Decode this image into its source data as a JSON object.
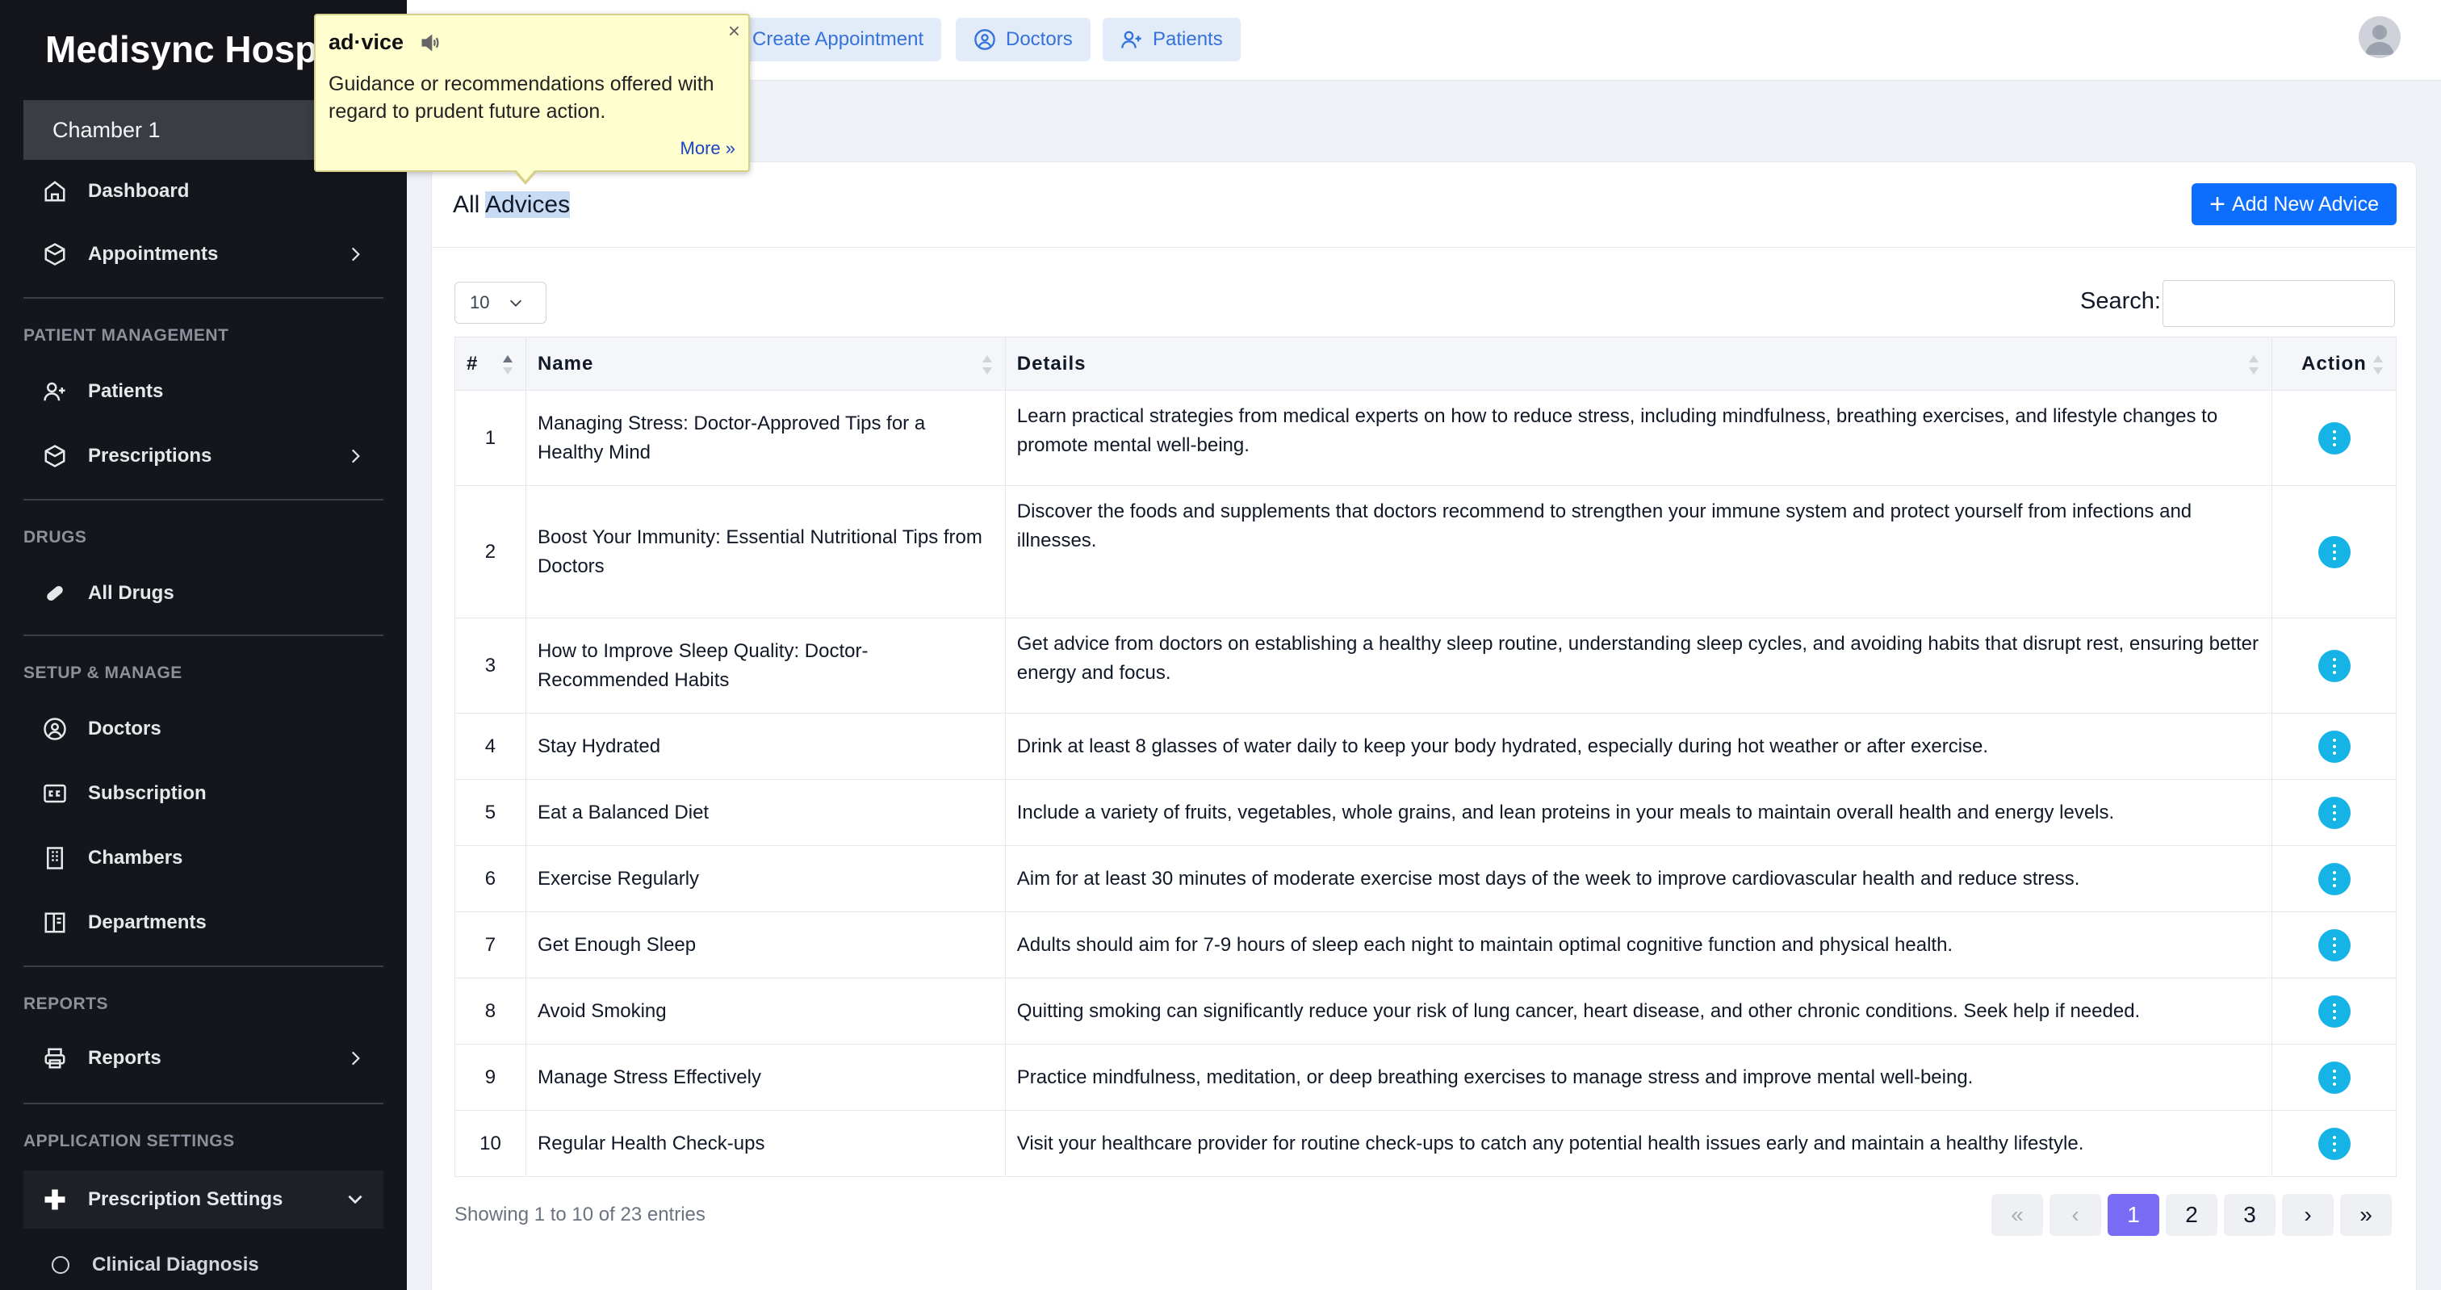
{
  "sidebar": {
    "brand": "Medisync Hospital",
    "chamber": "Chamber 1",
    "nav_top": [
      {
        "label": "Dashboard",
        "icon": "home-icon"
      },
      {
        "label": "Appointments",
        "icon": "hexagon-icon"
      }
    ],
    "sections": {
      "patient_management": "PATIENT MANAGEMENT",
      "drugs": "DRUGS",
      "setup_manage": "SETUP & MANAGE",
      "reports": "REPORTS",
      "application_settings": "APPLICATION SETTINGS"
    },
    "items": {
      "patients": "Patients",
      "prescriptions": "Prescriptions",
      "all_drugs": "All Drugs",
      "doctors": "Doctors",
      "subscription": "Subscription",
      "chambers": "Chambers",
      "departments": "Departments",
      "reports": "Reports",
      "prescription_settings": "Prescription Settings",
      "clinical_diagnosis": "Clinical Diagnosis"
    }
  },
  "topbar": {
    "create_appointment": "Create Appointment",
    "doctors": "Doctors",
    "patients": "Patients"
  },
  "card": {
    "title_prefix": "All ",
    "title_highlight": "Advices",
    "add_button": "Add New Advice",
    "page_length": "10",
    "search_label": "Search:"
  },
  "table": {
    "columns": [
      "#",
      "Name",
      "Details",
      "Action"
    ],
    "rows": [
      {
        "num": "1",
        "name": "Managing Stress: Doctor-Approved Tips for a Healthy Mind",
        "details": "Learn practical strategies from medical experts on how to reduce stress, including mindfulness, breathing exercises, and lifestyle changes to promote mental well-being."
      },
      {
        "num": "2",
        "name": "Boost Your Immunity: Essential Nutritional Tips from Doctors",
        "details": "Discover the foods and supplements that doctors recommend to strengthen your immune system and protect yourself from infections and illnesses."
      },
      {
        "num": "3",
        "name": "How to Improve Sleep Quality: Doctor-Recommended Habits",
        "details": "Get advice from doctors on establishing a healthy sleep routine, understanding sleep cycles, and avoiding habits that disrupt rest, ensuring better energy and focus."
      },
      {
        "num": "4",
        "name": "Stay Hydrated",
        "details": "Drink at least 8 glasses of water daily to keep your body hydrated, especially during hot weather or after exercise."
      },
      {
        "num": "5",
        "name": "Eat a Balanced Diet",
        "details": "Include a variety of fruits, vegetables, whole grains, and lean proteins in your meals to maintain overall health and energy levels."
      },
      {
        "num": "6",
        "name": "Exercise Regularly",
        "details": "Aim for at least 30 minutes of moderate exercise most days of the week to improve cardiovascular health and reduce stress."
      },
      {
        "num": "7",
        "name": "Get Enough Sleep",
        "details": "Adults should aim for 7-9 hours of sleep each night to maintain optimal cognitive function and physical health."
      },
      {
        "num": "8",
        "name": "Avoid Smoking",
        "details": "Quitting smoking can significantly reduce your risk of lung cancer, heart disease, and other chronic conditions. Seek help if needed."
      },
      {
        "num": "9",
        "name": "Manage Stress Effectively",
        "details": "Practice mindfulness, meditation, or deep breathing exercises to manage stress and improve mental well-being."
      },
      {
        "num": "10",
        "name": "Regular Health Check-ups",
        "details": "Visit your healthcare provider for routine check-ups to catch any potential health issues early and maintain a healthy lifestyle."
      }
    ]
  },
  "footer": {
    "info": "Showing 1 to 10 of 23 entries",
    "pages": {
      "first": "«",
      "prev": "‹",
      "p1": "1",
      "p2": "2",
      "p3": "3",
      "next": "›",
      "last": "»"
    }
  },
  "tooltip": {
    "word": "ad·vice",
    "definition": "Guidance or recommendations offered with regard to prudent future action.",
    "more": "More »",
    "close": "×"
  },
  "colors": {
    "sidebar_bg": "#14161c",
    "primary": "#0d6efd",
    "action": "#16b3e6",
    "active_page": "#7b6cf6",
    "tooltip_bg": "#fffecf"
  }
}
